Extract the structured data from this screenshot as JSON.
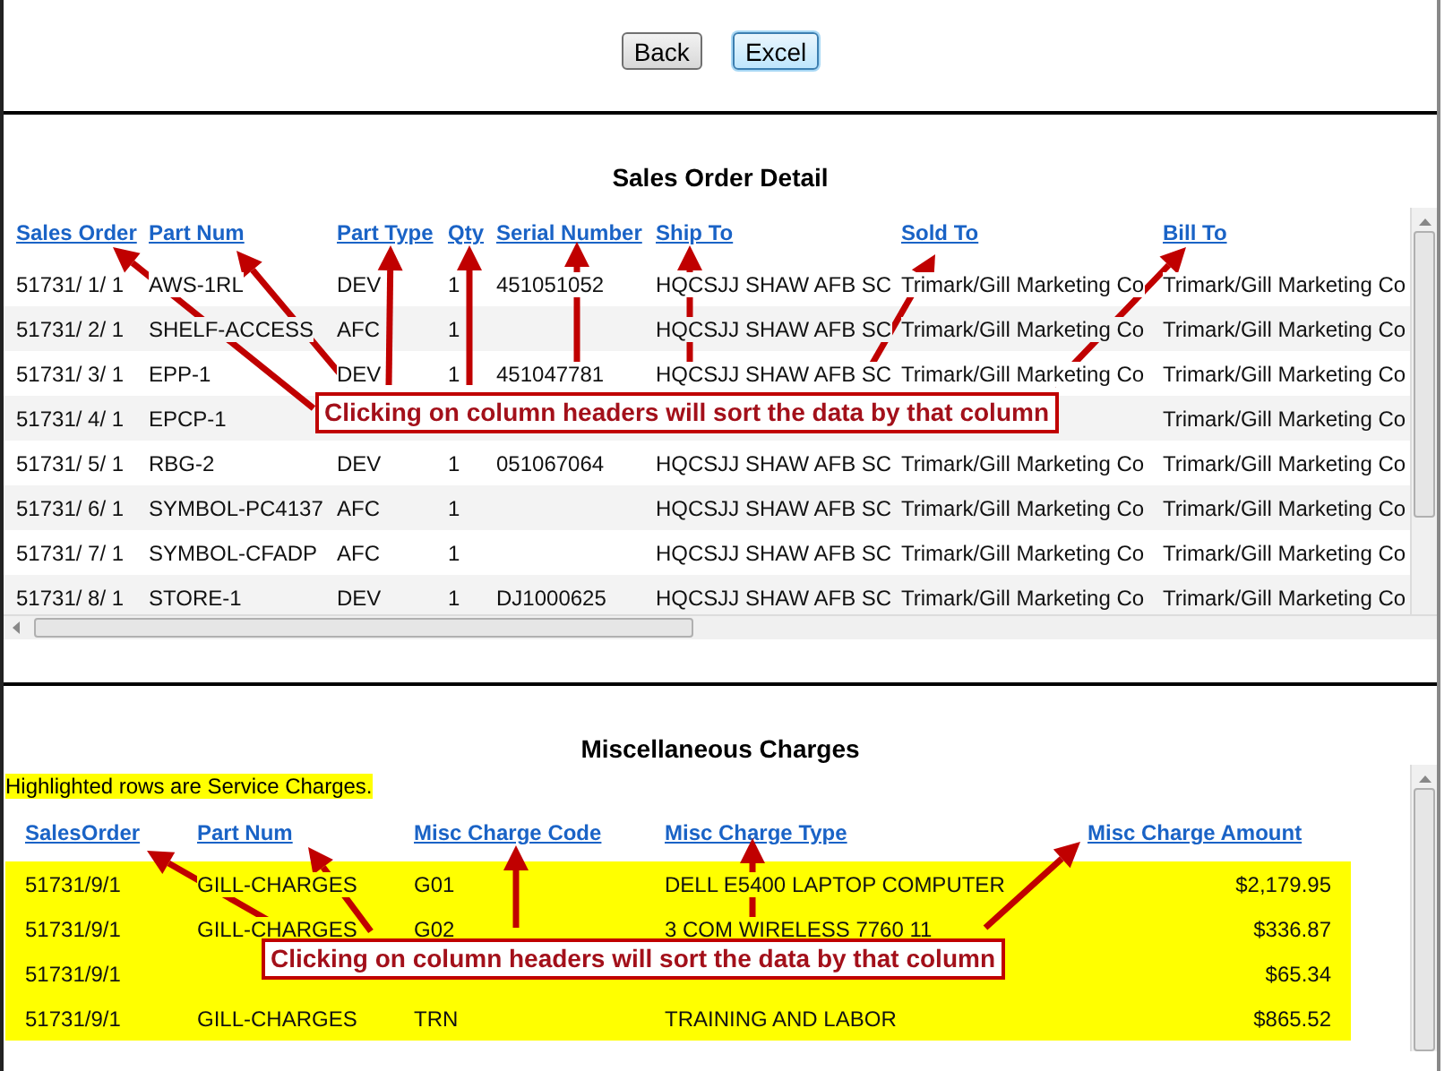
{
  "toolbar": {
    "buttons": [
      {
        "label": "Back",
        "focused": false
      },
      {
        "label": "Excel",
        "focused": true
      }
    ]
  },
  "sales_order_detail": {
    "title": "Sales Order Detail",
    "columns": [
      {
        "label": "Sales Order"
      },
      {
        "label": "Part Num"
      },
      {
        "label": "Part Type"
      },
      {
        "label": "Qty"
      },
      {
        "label": "Serial Number"
      },
      {
        "label": "Ship To"
      },
      {
        "label": "Sold To"
      },
      {
        "label": "Bill To"
      }
    ],
    "rows": [
      {
        "sales_order": "51731/ 1/ 1",
        "part_num": "AWS-1RL",
        "part_type": "DEV",
        "qty": "1",
        "serial_number": "451051052",
        "ship_to": "HQCSJJ SHAW AFB SC",
        "sold_to": "Trimark/Gill Marketing Co",
        "bill_to": "Trimark/Gill Marketing Co"
      },
      {
        "sales_order": "51731/ 2/ 1",
        "part_num": "SHELF-ACCESS",
        "part_type": "AFC",
        "qty": "1",
        "ship_to": "HQCSJJ SHAW AFB SC",
        "sold_to": "Trimark/Gill Marketing Co",
        "bill_to": "Trimark/Gill Marketing Co"
      },
      {
        "sales_order": "51731/ 3/ 1",
        "part_num": "EPP-1",
        "part_type": "DEV",
        "qty": "1",
        "serial_number": "451047781",
        "ship_to": "HQCSJJ SHAW AFB SC",
        "sold_to": "Trimark/Gill Marketing Co",
        "bill_to": "Trimark/Gill Marketing Co"
      },
      {
        "sales_order": "51731/ 4/ 1",
        "part_num": "EPCP-1",
        "bill_to": "Trimark/Gill Marketing Co"
      },
      {
        "sales_order": "51731/ 5/ 1",
        "part_num": "RBG-2",
        "part_type": "DEV",
        "qty": "1",
        "serial_number": "051067064",
        "ship_to": "HQCSJJ SHAW AFB SC",
        "sold_to": "Trimark/Gill Marketing Co",
        "bill_to": "Trimark/Gill Marketing Co"
      },
      {
        "sales_order": "51731/ 6/ 1",
        "part_num": "SYMBOL-PC4137",
        "part_type": "AFC",
        "qty": "1",
        "ship_to": "HQCSJJ SHAW AFB SC",
        "sold_to": "Trimark/Gill Marketing Co",
        "bill_to": "Trimark/Gill Marketing Co"
      },
      {
        "sales_order": "51731/ 7/ 1",
        "part_num": "SYMBOL-CFADP",
        "part_type": "AFC",
        "qty": "1",
        "ship_to": "HQCSJJ SHAW AFB SC",
        "sold_to": "Trimark/Gill Marketing Co",
        "bill_to": "Trimark/Gill Marketing Co"
      },
      {
        "sales_order": "51731/ 8/ 1",
        "part_num": "STORE-1",
        "part_type": "DEV",
        "qty": "1",
        "serial_number": "DJ1000625",
        "ship_to": "HQCSJJ SHAW AFB SC",
        "sold_to": "Trimark/Gill Marketing Co",
        "bill_to": "Trimark/Gill Marketing Co"
      }
    ],
    "callout": {
      "text": "Clicking on column headers will sort the data by that column"
    }
  },
  "miscellaneous_charges": {
    "title": "Miscellaneous Charges",
    "note": "Highlighted rows are Service Charges.",
    "columns": [
      {
        "label": "SalesOrder"
      },
      {
        "label": "Part Num"
      },
      {
        "label": "Misc Charge Code"
      },
      {
        "label": "Misc Charge Type"
      },
      {
        "label": "Misc Charge Amount"
      }
    ],
    "rows": [
      {
        "service_charge": true,
        "sales_order": "51731/9/1",
        "part_num": "GILL-CHARGES",
        "code": "G01",
        "type": "DELL E5400 LAPTOP COMPUTER",
        "amount": "$2,179.95"
      },
      {
        "service_charge": true,
        "sales_order": "51731/9/1",
        "part_num": "GILL-CHARGES",
        "code": "G02",
        "type": "3 COM WIRELESS 7760 11",
        "amount": "$336.87"
      },
      {
        "service_charge": true,
        "sales_order": "51731/9/1",
        "amount": "$65.34"
      },
      {
        "service_charge": true,
        "sales_order": "51731/9/1",
        "part_num": "GILL-CHARGES",
        "code": "TRN",
        "type": "TRAINING AND LABOR",
        "amount": "$865.52"
      }
    ],
    "callout": {
      "text": "Clicking on column headers will sort the data by that column"
    }
  }
}
